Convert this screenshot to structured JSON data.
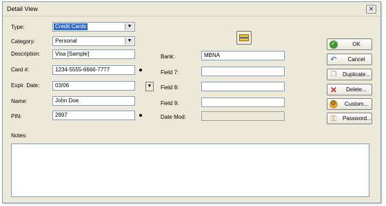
{
  "window": {
    "title": "Detail View",
    "close_glyph": "✕"
  },
  "labels": {
    "type": "Type:",
    "category": "Category:",
    "description": "Description:",
    "card_number": "Card #:",
    "expir_date": "Expir. Date:",
    "name": "Name:",
    "pin": "PIN:",
    "bank": "Bank:",
    "field7": "Field 7:",
    "field8": "Field 8:",
    "field9": "Field 9:",
    "date_mod": "Date Mod:",
    "notes": "Notes:"
  },
  "values": {
    "type": "Credit Cards",
    "category": "Personal",
    "description": "Visa [Sample]",
    "card_number": "1234-5555-6666-7777",
    "expir_date": "03/06",
    "name": "John Doe",
    "pin": "2897",
    "bank": "MBNA",
    "field7": "",
    "field8": "",
    "field9": "",
    "date_mod": "",
    "notes": ""
  },
  "buttons": {
    "ok": "OK",
    "cancel": "Cancel",
    "duplicate": "Duplicate...",
    "delete": "Delete...",
    "custom": "Custom...",
    "password": "Password..."
  },
  "icons": {
    "ok": "check-circle-icon",
    "cancel": "undo-arrow-icon",
    "duplicate": "copy-icon",
    "delete": "red-x-icon",
    "custom": "gear-icon",
    "password": "key-icon",
    "card": "credit-card-icon"
  },
  "colors": {
    "selection": "#316ac5",
    "window_bg": "#ece9d8",
    "field_border": "#7f9db9"
  }
}
